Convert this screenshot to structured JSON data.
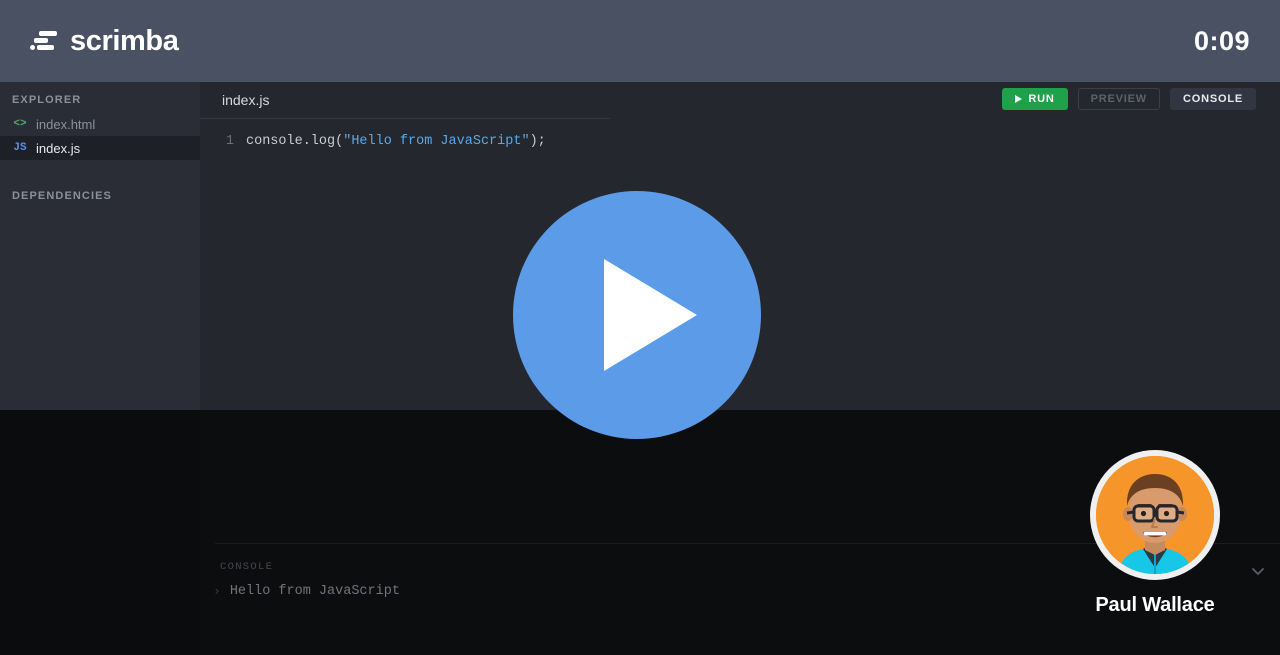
{
  "header": {
    "brand": "scrimba",
    "logo_icon": "scrimba-speedlines-icon",
    "timer": "0:09"
  },
  "sidebar": {
    "explorer_title": "EXPLORER",
    "dependencies_title": "DEPENDENCIES",
    "files": [
      {
        "name": "index.html",
        "icon": "html-code-icon",
        "icon_glyph": "<>",
        "active": false
      },
      {
        "name": "index.js",
        "icon": "js-file-icon",
        "icon_glyph": "JS",
        "active": true
      }
    ]
  },
  "editor": {
    "tab_label": "index.js",
    "toolbar": {
      "run_label": "RUN",
      "run_icon": "play-icon",
      "preview_label": "PREVIEW",
      "console_label": "CONSOLE"
    },
    "code": {
      "line_number": "1",
      "before_string": "console.log(",
      "string_literal": "\"Hello from JavaScript\"",
      "after_string": ");"
    }
  },
  "console": {
    "label": "CONSOLE",
    "caret": "›",
    "output": "Hello from JavaScript",
    "collapse_icon": "chevron-down-icon"
  },
  "player": {
    "play_icon": "play-icon"
  },
  "presenter": {
    "name": "Paul Wallace",
    "avatar_icon": "presenter-avatar"
  },
  "colors": {
    "header_bg": "#4a5163",
    "sidebar_bg": "#2a2d35",
    "editor_bg": "#24272d",
    "lower_bg": "#0b0c0d",
    "run_green": "#1ea14a",
    "play_blue": "#5b9be8",
    "string_blue": "#5aa9e6",
    "js_icon_blue": "#5b8def",
    "html_icon_green": "#4caf6d",
    "avatar_orange": "#f6962a"
  }
}
